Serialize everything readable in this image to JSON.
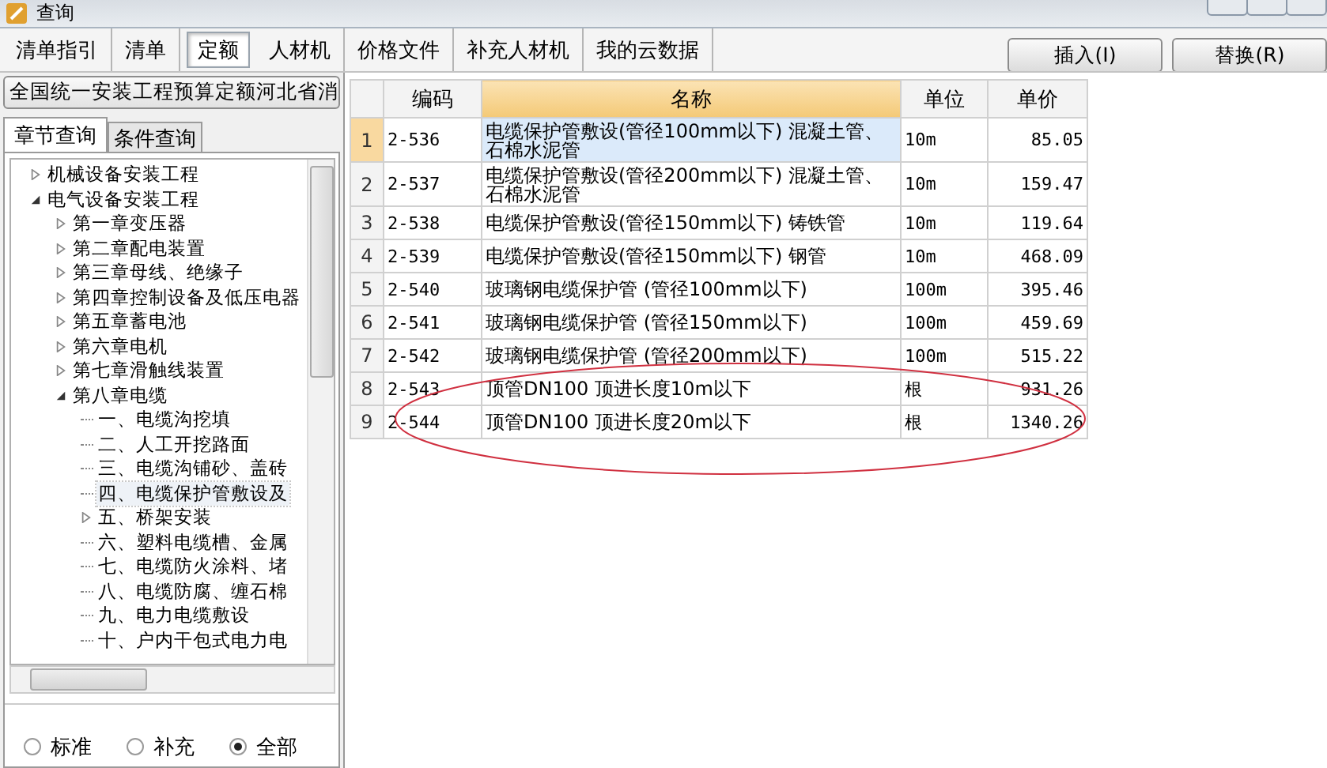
{
  "window": {
    "title": "查询"
  },
  "tabs": [
    {
      "label": "清单指引",
      "selected": false
    },
    {
      "label": "清单",
      "selected": false
    },
    {
      "label": "定额",
      "selected": true
    },
    {
      "label": "人材机",
      "selected": false
    },
    {
      "label": "价格文件",
      "selected": false
    },
    {
      "label": "补充人材机",
      "selected": false
    },
    {
      "label": "我的云数据",
      "selected": false
    }
  ],
  "buttons": [
    "插入(I)",
    "替换(R)"
  ],
  "library_select": {
    "value": "全国统一安装工程预算定额河北省消"
  },
  "sub_tabs": [
    {
      "label": "章节查询",
      "selected": true
    },
    {
      "label": "条件查询",
      "selected": false
    }
  ],
  "tree": [
    {
      "label": "机械设备安装工程",
      "expanded": false,
      "selected": false
    },
    {
      "label": "电气设备安装工程",
      "expanded": true,
      "selected": false,
      "children": [
        {
          "label": "第一章变压器",
          "expanded": false,
          "selected": false
        },
        {
          "label": "第二章配电装置",
          "expanded": false,
          "selected": false
        },
        {
          "label": "第三章母线、绝缘子",
          "expanded": false,
          "selected": false
        },
        {
          "label": "第四章控制设备及低压电器",
          "expanded": false,
          "selected": false
        },
        {
          "label": "第五章蓄电池",
          "expanded": false,
          "selected": false
        },
        {
          "label": "第六章电机",
          "expanded": false,
          "selected": false
        },
        {
          "label": "第七章滑触线装置",
          "expanded": false,
          "selected": false
        },
        {
          "label": "第八章电缆",
          "expanded": true,
          "selected": false,
          "children": [
            {
              "label": "一、电缆沟挖填",
              "selected": false
            },
            {
              "label": "二、人工开挖路面",
              "selected": false
            },
            {
              "label": "三、电缆沟铺砂、盖砖",
              "selected": false
            },
            {
              "label": "四、电缆保护管敷设及",
              "selected": true
            },
            {
              "label": "五、桥架安装",
              "expanded": false,
              "selected": false
            },
            {
              "label": "六、塑料电缆槽、金属",
              "selected": false
            },
            {
              "label": "七、电缆防火涂料、堵",
              "selected": false
            },
            {
              "label": "八、电缆防腐、缠石棉",
              "selected": false
            },
            {
              "label": "九、电力电缆敷设",
              "selected": false
            },
            {
              "label": "十、户内干包式电力电",
              "selected": false
            }
          ]
        }
      ]
    }
  ],
  "filter_options": [
    {
      "label": "标准",
      "selected": false
    },
    {
      "label": "补充",
      "selected": false
    },
    {
      "label": "全部",
      "selected": true
    }
  ],
  "table": {
    "columns": [
      "编码",
      "名称",
      "单位",
      "单价"
    ],
    "rows": [
      {
        "index": "1",
        "code": "2-536",
        "name": "电缆保护管敷设(管径100mm以下) 混凝土管、石棉水泥管",
        "unit": "10m",
        "price": "85.05",
        "selected": true
      },
      {
        "index": "2",
        "code": "2-537",
        "name": "电缆保护管敷设(管径200mm以下) 混凝土管、石棉水泥管",
        "unit": "10m",
        "price": "159.47",
        "selected": false
      },
      {
        "index": "3",
        "code": "2-538",
        "name": "电缆保护管敷设(管径150mm以下) 铸铁管",
        "unit": "10m",
        "price": "119.64",
        "selected": false
      },
      {
        "index": "4",
        "code": "2-539",
        "name": "电缆保护管敷设(管径150mm以下) 钢管",
        "unit": "10m",
        "price": "468.09",
        "selected": false
      },
      {
        "index": "5",
        "code": "2-540",
        "name": "玻璃钢电缆保护管 (管径100mm以下)",
        "unit": "100m",
        "price": "395.46",
        "selected": false
      },
      {
        "index": "6",
        "code": "2-541",
        "name": "玻璃钢电缆保护管 (管径150mm以下)",
        "unit": "100m",
        "price": "459.69",
        "selected": false
      },
      {
        "index": "7",
        "code": "2-542",
        "name": "玻璃钢电缆保护管 (管径200mm以下)",
        "unit": "100m",
        "price": "515.22",
        "selected": false
      },
      {
        "index": "8",
        "code": "2-543",
        "name": "顶管DN100 顶进长度10m以下",
        "unit": "根",
        "price": "931.26",
        "selected": false
      },
      {
        "index": "9",
        "code": "2-544",
        "name": "顶管DN100 顶进长度20m以下",
        "unit": "根",
        "price": "1340.26",
        "selected": false
      }
    ]
  }
}
